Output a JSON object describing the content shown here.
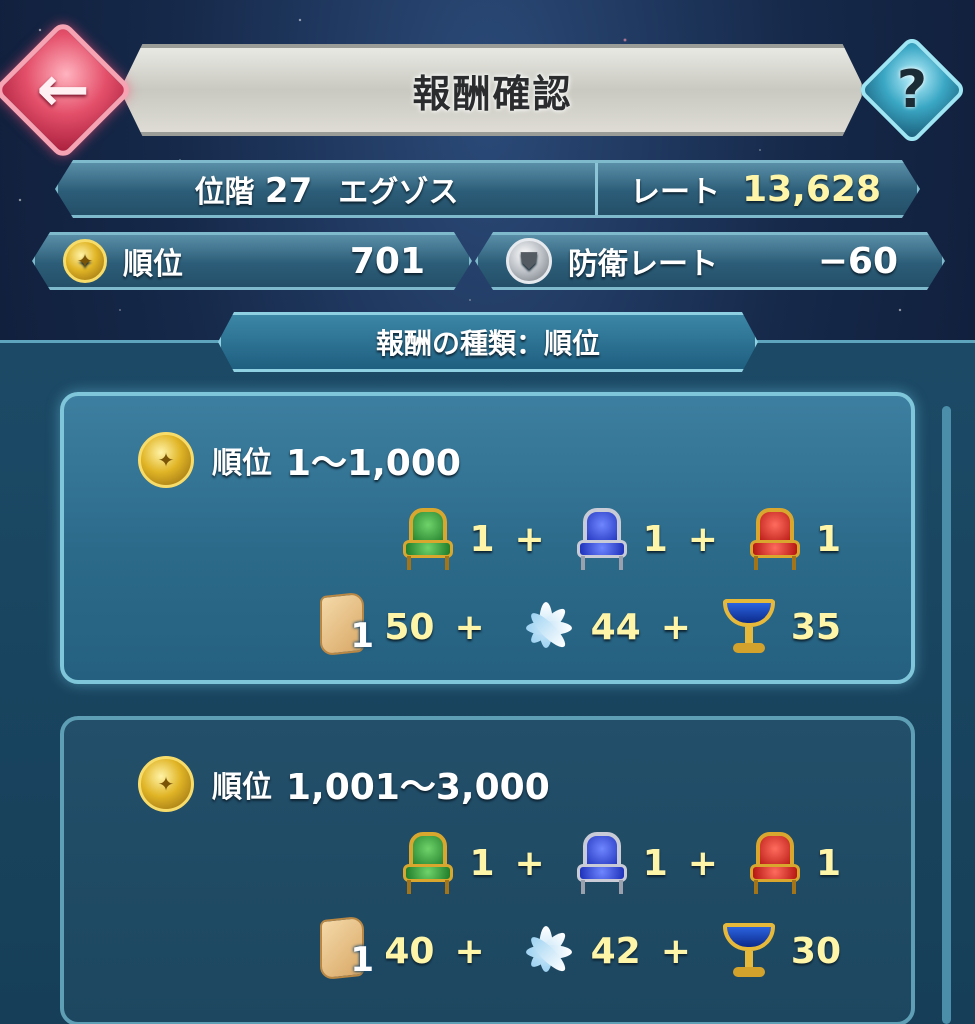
{
  "header": {
    "title": "報酬確認",
    "back_icon": "back-arrow-icon",
    "help_icon": "question-mark-icon",
    "help_label": "?"
  },
  "rank_bar": {
    "tier_label": "位階",
    "tier_number": "27",
    "tier_name": "エグゾス",
    "rate_label": "レート",
    "rate_value": "13,628"
  },
  "placement": {
    "label": "順位",
    "value": "701"
  },
  "defense": {
    "label": "防衛レート",
    "value": "−60"
  },
  "reward_type": {
    "label": "報酬の種類：順位"
  },
  "tiers": [
    {
      "label": "順位",
      "range": "1～1,000",
      "thrones": {
        "green": "1",
        "blue": "1",
        "red": "1"
      },
      "items": {
        "scroll_badge": "1",
        "scroll": "50",
        "lotus": "44",
        "grail": "35"
      }
    },
    {
      "label": "順位",
      "range": "1,001～3,000",
      "thrones": {
        "green": "1",
        "blue": "1",
        "red": "1"
      },
      "items": {
        "scroll_badge": "1",
        "scroll": "40",
        "lotus": "42",
        "grail": "30"
      }
    }
  ],
  "plus_sign": "+",
  "colors": {
    "accent_gold": "#fff5a8",
    "back_button": "#e4506a",
    "help_button": "#3aa7c4",
    "panel": "#1c4a66"
  }
}
